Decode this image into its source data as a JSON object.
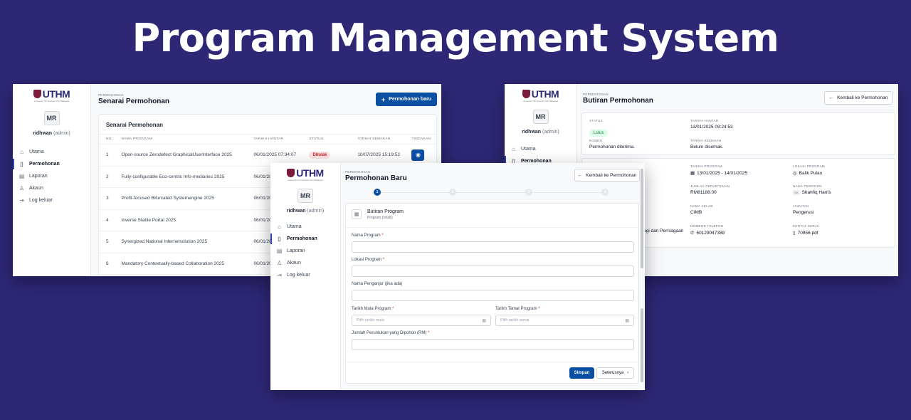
{
  "hero_title": "Program Management System",
  "brand": {
    "logo_text": "UTHM",
    "logo_sub": "Universiti Tun Hussein Onn Malaysia"
  },
  "user": {
    "initials": "MR",
    "name": "ridhwan",
    "role": "(admin)"
  },
  "nav": [
    "Utama",
    "Permohonan",
    "Laporan",
    "Akaun",
    "Log keluar"
  ],
  "list_page": {
    "eyebrow": "PERMOHONAN",
    "title": "Senarai Permohonan",
    "new_button": "Permohonan baru",
    "card_title": "Senarai Permohonan",
    "headers": [
      "NO.",
      "NAMA PROGRAM",
      "TARIKH HANTAR",
      "STATUS",
      "TARIKH SEMAKAN",
      "TINDAKAN"
    ],
    "rows": [
      {
        "no": "1",
        "name": "Open-source Zerodefect GraphicalUserInterface 2025",
        "date": "06/01/2025 07:34:07",
        "status": "Ditolak",
        "review": "10/07/2025 15:19:52"
      },
      {
        "no": "2",
        "name": "Fully-configurable Eco-centric Info-mediaries 2025",
        "date": "06/01/20",
        "status": "",
        "review": ""
      },
      {
        "no": "3",
        "name": "Profit-focused Bifurcated Systemengine 2025",
        "date": "06/01/20",
        "status": "",
        "review": ""
      },
      {
        "no": "4",
        "name": "Inverse Stable Portal 2025",
        "date": "06/01/20",
        "status": "",
        "review": ""
      },
      {
        "no": "5",
        "name": "Synergized National Internetsolution 2025",
        "date": "06/01/20",
        "status": "",
        "review": ""
      },
      {
        "no": "6",
        "name": "Mandatory Contextually-based Collaboration 2025",
        "date": "06/01/20",
        "status": "",
        "review": ""
      }
    ]
  },
  "detail_page": {
    "eyebrow": "PERMOHONAN",
    "title": "Butiran Permohonan",
    "back_button": "Kembali ke Permohonan",
    "status_label": "STATUS",
    "status_value": "Lulus",
    "sent_label": "TARIKH HANTAR",
    "sent_value": "13/01/2025 09:24:53",
    "comment_label": "KOMEN",
    "comment_value": "Permohonan diterima.",
    "review_label": "TARIKH SEMAKAN",
    "review_value": "Belum disemak.",
    "program_date_label": "TARIKH PROGRAM",
    "program_date_value": "13/01/2025 - 14/01/2025",
    "location_label": "LOKASI PROGRAM",
    "location_value": "Balik Pulau",
    "amount_label": "JUMLAH PERUNTUKAN",
    "amount_value": "RM81188.00",
    "applicant_label": "NAMA PEMOHON",
    "applicant_initials": "SH",
    "applicant_value": "Shahfiq Harris",
    "class_label": "NAMA KELAB",
    "class_value": "CIMB",
    "position_label": "JAWATAN",
    "position_value": "Pengerusi",
    "phone_label": "NOMBOR TELEFON",
    "phone_value": "60129047388",
    "paper_label": "KERTAS KERJA",
    "paper_value": "70956.pdf",
    "partial_value": "ogi dan Perniagaan"
  },
  "form_page": {
    "eyebrow": "PERMOHONAN",
    "title": "Permohonan Baru",
    "back_button": "Kembali ke Permohonan",
    "steps": [
      "1",
      "2",
      "3",
      "4"
    ],
    "section_title": "Butiran Program",
    "section_sub": "Program Details",
    "f_name": "Nama Program",
    "f_location": "Lokasi Program",
    "f_organizer": "Nama Penganjur (jika ada)",
    "f_start": "Tarikh Mula Program",
    "f_end": "Tarikh Tamat Program",
    "start_placeholder": "Pilih tarikh mula",
    "end_placeholder": "Pilih tarikh tamat",
    "f_amount": "Jumlah Peruntukan yang Dipohon (RM)",
    "required_mark": "*",
    "save_button": "Simpan",
    "next_button": "Seterusnya"
  }
}
